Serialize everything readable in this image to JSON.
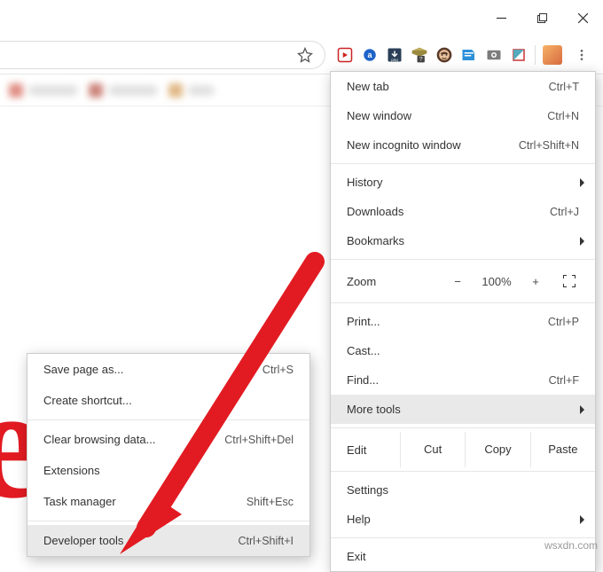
{
  "window_controls": {
    "minimize": "Minimize",
    "maximize": "Maximize",
    "close": "Close"
  },
  "menu": {
    "new_tab": "New tab",
    "new_tab_sc": "Ctrl+T",
    "new_window": "New window",
    "new_window_sc": "Ctrl+N",
    "new_incognito": "New incognito window",
    "new_incognito_sc": "Ctrl+Shift+N",
    "history": "History",
    "downloads": "Downloads",
    "downloads_sc": "Ctrl+J",
    "bookmarks": "Bookmarks",
    "zoom_label": "Zoom",
    "zoom_value": "100%",
    "print": "Print...",
    "print_sc": "Ctrl+P",
    "cast": "Cast...",
    "find": "Find...",
    "find_sc": "Ctrl+F",
    "more_tools": "More tools",
    "edit_label": "Edit",
    "cut": "Cut",
    "copy": "Copy",
    "paste": "Paste",
    "settings": "Settings",
    "help": "Help",
    "exit": "Exit"
  },
  "sub": {
    "save_page": "Save page as...",
    "save_page_sc": "Ctrl+S",
    "create_shortcut": "Create shortcut...",
    "clear_data": "Clear browsing data...",
    "clear_data_sc": "Ctrl+Shift+Del",
    "extensions": "Extensions",
    "task_manager": "Task manager",
    "task_manager_sc": "Shift+Esc",
    "developer_tools": "Developer tools",
    "developer_tools_sc": "Ctrl+Shift+I"
  },
  "watermark": "wsxdn.com"
}
